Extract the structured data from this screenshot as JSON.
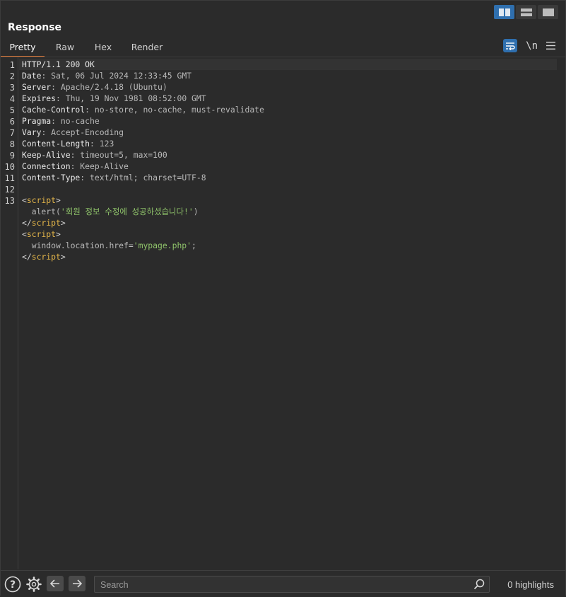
{
  "layout_toggle": {
    "icons": [
      "split-vertical-icon",
      "split-horizontal-icon",
      "single-pane-icon"
    ],
    "active_index": 0
  },
  "panel": {
    "title": "Response"
  },
  "tabs": [
    {
      "label": "Pretty",
      "active": true
    },
    {
      "label": "Raw",
      "active": false
    },
    {
      "label": "Hex",
      "active": false
    },
    {
      "label": "Render",
      "active": false
    }
  ],
  "tools": {
    "wrap_icon": "wrap-lines-icon",
    "newline_label": "\\n",
    "menu_icon": "hamburger-menu-icon"
  },
  "editor": {
    "line_numbers": [
      "1",
      "2",
      "3",
      "4",
      "5",
      "6",
      "7",
      "8",
      "9",
      "10",
      "11",
      "12",
      "13"
    ],
    "headers": {
      "status": "HTTP/1.1 200 OK",
      "date_key": "Date",
      "date_val": "Sat, 06 Jul 2024 12:33:45 GMT",
      "server_key": "Server",
      "server_val": "Apache/2.4.18 (Ubuntu)",
      "expires_key": "Expires",
      "expires_val": "Thu, 19 Nov 1981 08:52:00 GMT",
      "cache_key": "Cache-Control",
      "cache_val": "no-store, no-cache, must-revalidate",
      "pragma_key": "Pragma",
      "pragma_val": "no-cache",
      "vary_key": "Vary",
      "vary_val": "Accept-Encoding",
      "length_key": "Content-Length",
      "length_val": "123",
      "keepalive_key": "Keep-Alive",
      "keepalive_val": "timeout=5, max=100",
      "connection_key": "Connection",
      "connection_val": "Keep-Alive",
      "ctype_key": "Content-Type",
      "ctype_val": "text/html; charset=UTF-8",
      "separator": ": "
    },
    "body": {
      "open_lt": "<",
      "close_lt": "</",
      "gt": ">",
      "tag": "script",
      "alert_prefix": "  alert(",
      "alert_string": "'회원 정보 수정에 성공하셨습니다!'",
      "alert_suffix": ")",
      "location_prefix": "  window.location.href=",
      "location_string": "'mypage.php'",
      "location_suffix": ";"
    }
  },
  "bottom": {
    "help_icon": "help-icon",
    "settings_icon": "gear-icon",
    "back_icon": "arrow-left-icon",
    "forward_icon": "arrow-right-icon",
    "search_placeholder": "Search",
    "search_value": "",
    "highlights_text": "0 highlights"
  },
  "colors": {
    "accent": "#2f6fae",
    "tab_underline": "#e07a3a",
    "tag": "#e4b64a",
    "string": "#8fc36a",
    "background": "#2b2b2b"
  }
}
